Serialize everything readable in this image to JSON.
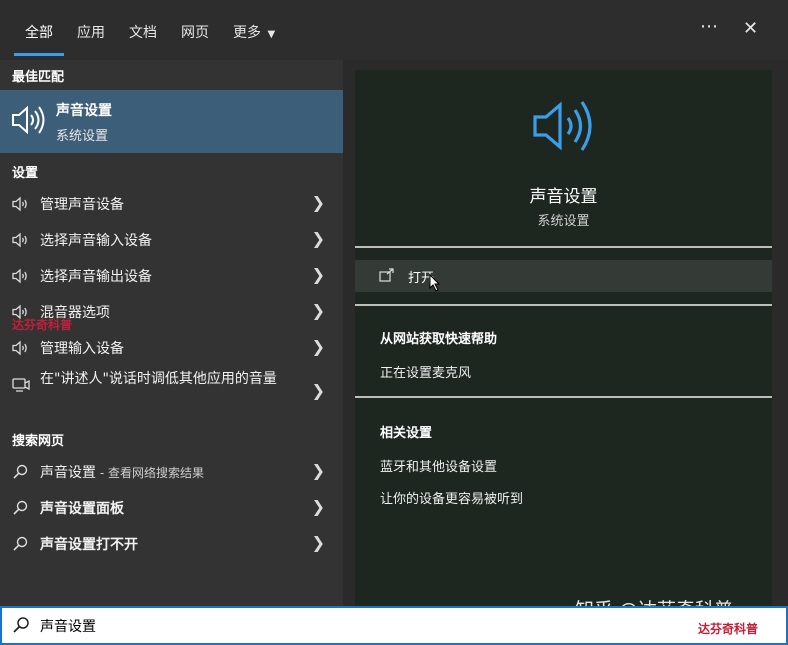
{
  "header": {
    "tabs": [
      {
        "label": "全部",
        "active": true
      },
      {
        "label": "应用"
      },
      {
        "label": "文档"
      },
      {
        "label": "网页"
      },
      {
        "label": "更多"
      }
    ],
    "more_icon": "ellipsis-icon",
    "close_icon": "close-icon"
  },
  "left": {
    "best_match_header": "最佳匹配",
    "best_match": {
      "title": "声音设置",
      "subtitle": "系统设置",
      "icon": "speaker-icon"
    },
    "settings_header": "设置",
    "settings_items": [
      {
        "label": "管理声音设备",
        "icon": "speaker-icon"
      },
      {
        "label": "选择声音输入设备",
        "icon": "speaker-icon"
      },
      {
        "label": "选择声音输出设备",
        "icon": "speaker-icon"
      },
      {
        "label": "混音器选项",
        "icon": "speaker-icon"
      },
      {
        "label": "管理输入设备",
        "icon": "speaker-icon"
      },
      {
        "label": "在\"讲述人\"说话时调低其他应用的音量",
        "icon": "narrator-icon"
      }
    ],
    "web_header": "搜索网页",
    "web_items": [
      {
        "label": "声音设置",
        "suffix": " - 查看网络搜索结果",
        "icon": "search-icon"
      },
      {
        "label": "声音设置面板",
        "icon": "search-icon"
      },
      {
        "label": "声音设置打不开",
        "icon": "search-icon"
      }
    ]
  },
  "right": {
    "title": "声音设置",
    "subtitle": "系统设置",
    "open_label": "打开",
    "web_help_header": "从网站获取快速帮助",
    "web_help_links": [
      "正在设置麦克风"
    ],
    "related_header": "相关设置",
    "related_links": [
      "蓝牙和其他设备设置",
      "让你的设备更容易被听到"
    ]
  },
  "search": {
    "value": "声音设置"
  },
  "watermark": {
    "text": "知乎 @达芬奇科普",
    "red_text": "达芬奇科普"
  },
  "colors": {
    "accent": "#3a9ee8",
    "selected": "#3d5e78",
    "search_border": "#1a73c9"
  }
}
